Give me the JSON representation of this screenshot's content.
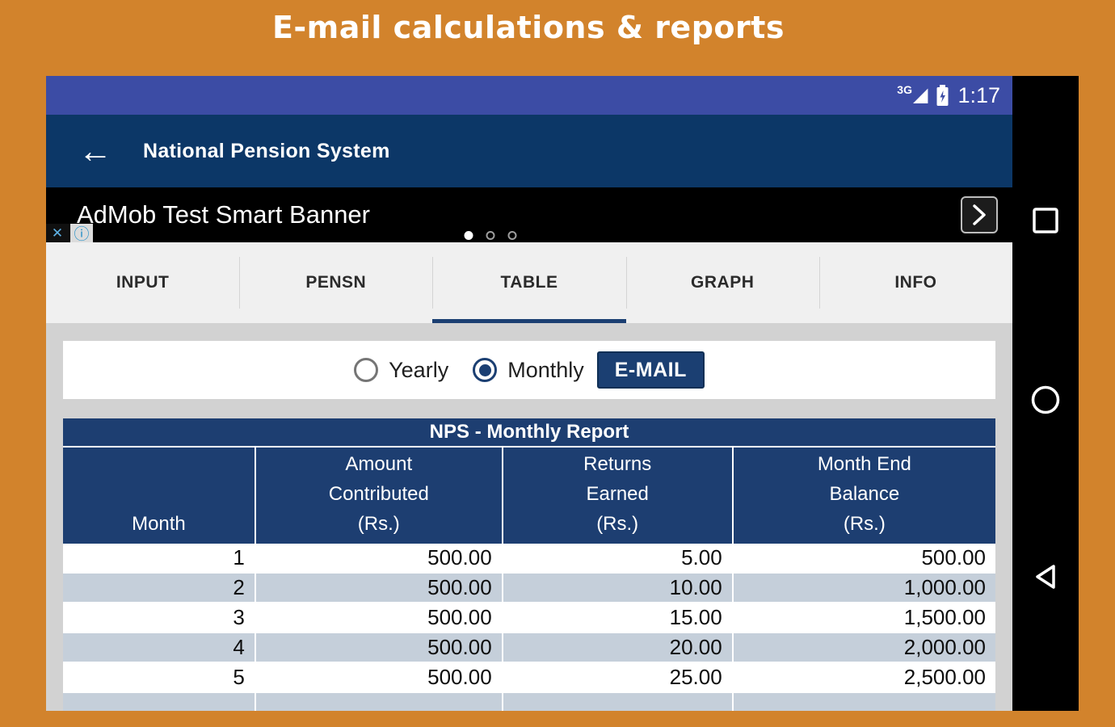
{
  "page": {
    "title": "E-mail calculations & reports"
  },
  "colors": {
    "background_orange": "#D2832C",
    "statusbar_indigo": "#3C4CA5",
    "appbar_navy": "#0C3767",
    "table_navy": "#1D3E71",
    "accent_navy": "#1B3F72",
    "row_alt": "#C5CFDA"
  },
  "statusbar": {
    "network": "3G",
    "time": "1:17"
  },
  "appbar": {
    "title": "National Pension System"
  },
  "ad_banner": {
    "text": "AdMob Test Smart Banner"
  },
  "icons": {
    "back_arrow": "←",
    "signal_triangle": "◢",
    "ad_close": "✕",
    "ad_info": "ⓘ"
  },
  "tabs": [
    {
      "label": "INPUT"
    },
    {
      "label": "PENSN"
    },
    {
      "label": "TABLE"
    },
    {
      "label": "GRAPH"
    },
    {
      "label": "INFO"
    }
  ],
  "active_tab": "TABLE",
  "controls": {
    "yearly_label": "Yearly",
    "monthly_label": "Monthly",
    "selected_option": "Monthly",
    "email_button": "E-MAIL"
  },
  "report_table": {
    "title": "NPS - Monthly Report",
    "columns": [
      {
        "lines": [
          "Month"
        ]
      },
      {
        "lines": [
          "Amount",
          "Contributed",
          "(Rs.)"
        ]
      },
      {
        "lines": [
          "Returns",
          "Earned",
          "(Rs.)"
        ]
      },
      {
        "lines": [
          "Month End",
          "Balance",
          "(Rs.)"
        ]
      }
    ],
    "rows": [
      [
        "1",
        "500.00",
        "5.00",
        "500.00"
      ],
      [
        "2",
        "500.00",
        "10.00",
        "1,000.00"
      ],
      [
        "3",
        "500.00",
        "15.00",
        "1,500.00"
      ],
      [
        "4",
        "500.00",
        "20.00",
        "2,000.00"
      ],
      [
        "5",
        "500.00",
        "25.00",
        "2,500.00"
      ]
    ]
  }
}
